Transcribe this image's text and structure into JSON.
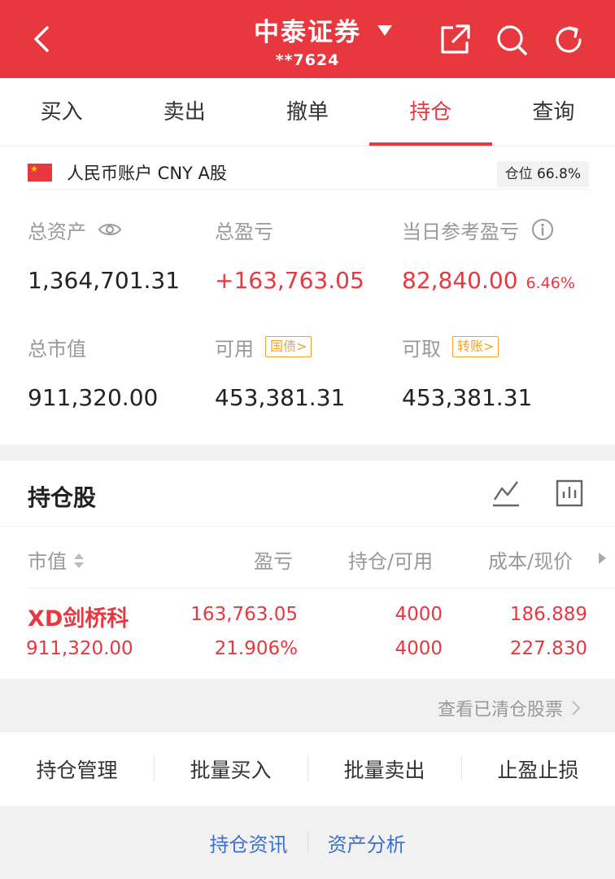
{
  "header": {
    "title": "中泰证券",
    "account_no": "**7624",
    "icons": [
      "back-icon",
      "caret-down-icon",
      "share-icon",
      "search-icon",
      "refresh-icon"
    ]
  },
  "tabs": [
    {
      "label": "买入",
      "active": false
    },
    {
      "label": "卖出",
      "active": false
    },
    {
      "label": "撤单",
      "active": false
    },
    {
      "label": "持仓",
      "active": true
    },
    {
      "label": "查询",
      "active": false
    }
  ],
  "account": {
    "label": "人民币账户 CNY A股",
    "position_label": "仓位",
    "position_value": "66.8%",
    "total_assets_label": "总资产",
    "total_assets": "1,364,701.31",
    "total_pnl_label": "总盈亏",
    "total_pnl": "+163,763.05",
    "daily_pnl_label": "当日参考盈亏",
    "daily_pnl": "82,840.00",
    "daily_pnl_pct": "6.46%",
    "market_value_label": "总市值",
    "market_value": "911,320.00",
    "available_label": "可用",
    "available_tag": "国债>",
    "available": "453,381.31",
    "withdrawable_label": "可取",
    "withdrawable_tag": "转账>",
    "withdrawable": "453,381.31"
  },
  "holdings": {
    "title": "持仓股",
    "columns": [
      "市值",
      "盈亏",
      "持仓/可用",
      "成本/现价"
    ],
    "rows": [
      {
        "name": "XD剑桥科",
        "market_value": "911,320.00",
        "pnl": "163,763.05",
        "pnl_pct": "21.906%",
        "position": "4000",
        "available": "4000",
        "cost": "186.889",
        "price": "227.830"
      }
    ]
  },
  "cleared_link": "查看已清仓股票",
  "actions": [
    "持仓管理",
    "批量买入",
    "批量卖出",
    "止盈止损"
  ],
  "footer_links": [
    "持仓资讯",
    "资产分析"
  ],
  "colors": {
    "brand_red": "#e8383f",
    "tag_orange": "#f1a32a",
    "link_blue": "#3b6fd0"
  }
}
